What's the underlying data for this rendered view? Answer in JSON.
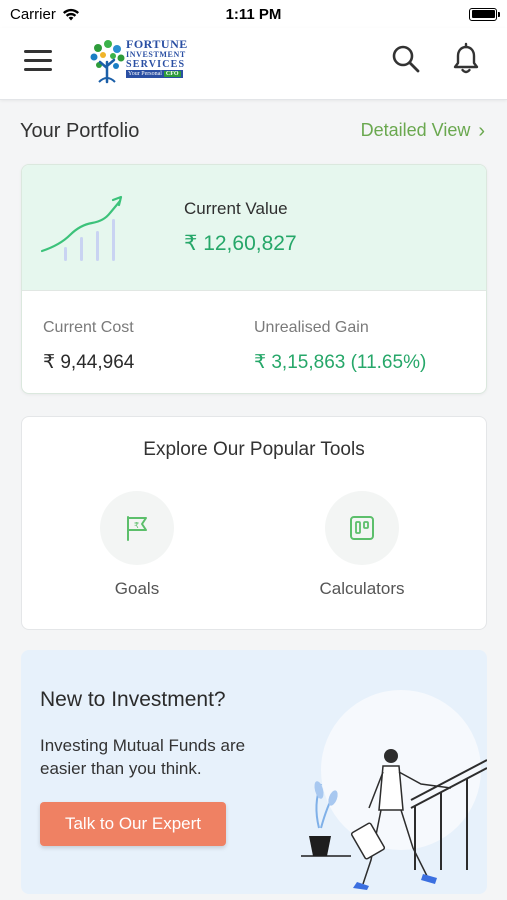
{
  "status_bar": {
    "carrier": "Carrier",
    "time": "1:11 PM",
    "wifi_icon": "wifi-icon",
    "battery_icon": "battery-icon"
  },
  "header": {
    "menu_icon": "hamburger-menu-icon",
    "logo": {
      "line1": "FORTUNE",
      "line2": "INVESTMENT",
      "line3": "SERVICES",
      "tagline": "Your Personal",
      "tagline_badge": "CFO"
    },
    "search_icon": "search-icon",
    "notification_icon": "bell-icon"
  },
  "portfolio": {
    "title": "Your Portfolio",
    "detailed_view": "Detailed View",
    "chevron": "›",
    "current_value_label": "Current Value",
    "current_value": "₹ 12,60,827",
    "current_cost_label": "Current Cost",
    "current_cost": "₹ 9,44,964",
    "unrealised_gain_label": "Unrealised Gain",
    "unrealised_gain": "₹ 3,15,863 (11.65%)"
  },
  "tools": {
    "title": "Explore Our Popular Tools",
    "items": [
      {
        "label": "Goals",
        "icon": "goal-flag-icon"
      },
      {
        "label": "Calculators",
        "icon": "calculator-icon"
      }
    ]
  },
  "promo": {
    "title": "New to Investment?",
    "subtitle": "Investing Mutual Funds are easier than you think.",
    "button": "Talk to Our Expert"
  },
  "colors": {
    "accent_green": "#26a769",
    "link_green": "#6aa84f",
    "card_green_bg": "#e6f7ee",
    "promo_bg": "#e7f1fb",
    "button_orange": "#ef8163"
  }
}
